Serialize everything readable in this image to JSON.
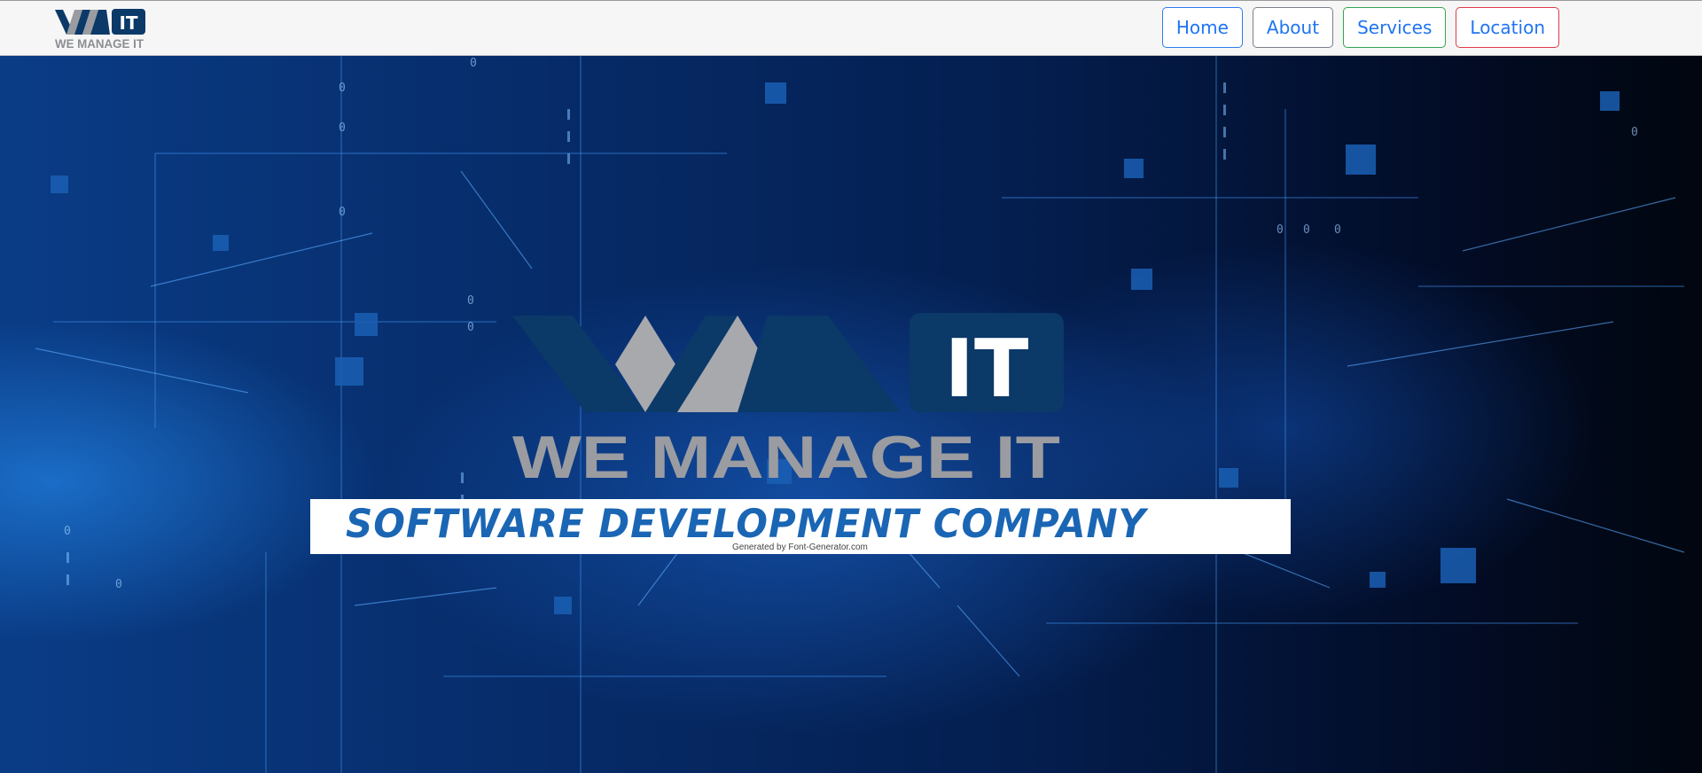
{
  "brand": {
    "logo_text": "WE MANAGE IT",
    "logo_badge": "IT"
  },
  "nav": {
    "items": [
      {
        "label": "Home"
      },
      {
        "label": "About"
      },
      {
        "label": "Services"
      },
      {
        "label": "Location"
      }
    ]
  },
  "hero": {
    "logo_text": "WE MANAGE IT",
    "logo_badge": "IT",
    "tagline": "SOFTWARE DEVELOPMENT  COMPANY",
    "credit": "Generated by Font-Generator.com"
  },
  "colors": {
    "brand_navy": "#0b3968",
    "brand_gray": "#9a9ca1",
    "tagline_blue": "#1a66b4",
    "navbar_bg": "#f6f6f6"
  },
  "icons": [
    "we-manage-it-logo",
    "hero-logo"
  ]
}
